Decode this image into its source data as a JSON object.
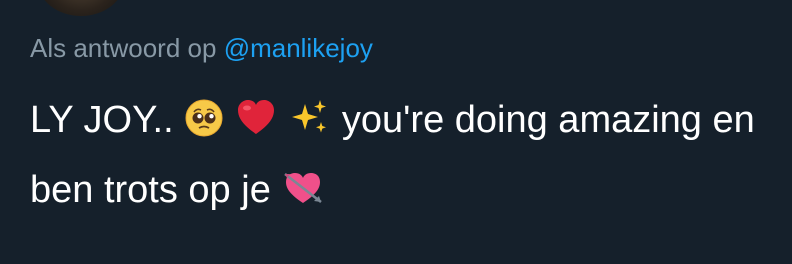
{
  "reply": {
    "prefix": "Als antwoord op",
    "handle": "@manlikejoy"
  },
  "tweet": {
    "part1": "LY JOY..",
    "part2": " you're doing amazing en ben trots op je",
    "emojis": [
      "pleading-face",
      "red-heart",
      "sparkles",
      "heart-with-arrow"
    ]
  },
  "colors": {
    "background": "#15202b",
    "muted": "#8899a6",
    "accent": "#1da1f2",
    "text": "#ffffff"
  }
}
